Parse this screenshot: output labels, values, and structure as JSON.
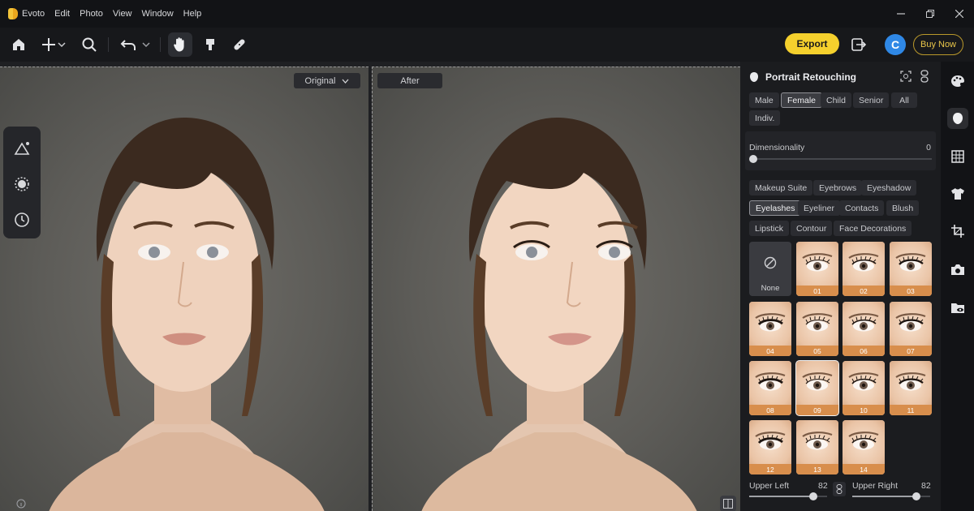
{
  "app": {
    "title": "Evoto"
  },
  "menu": [
    "Edit",
    "Photo",
    "View",
    "Window",
    "Help"
  ],
  "toolbar": {
    "export_label": "Export",
    "avatar_letter": "C",
    "buy_label": "Buy Now"
  },
  "canvas": {
    "left_label": "Original",
    "right_label": "After"
  },
  "panel": {
    "title": "Portrait Retouching",
    "filters": [
      "Male",
      "Female",
      "Child",
      "Senior",
      "All",
      "Indiv."
    ],
    "selected_filter": "Female",
    "dimensionality": {
      "label": "Dimensionality",
      "value": "0"
    },
    "makeup_tabs": [
      "Makeup Suite",
      "Eyebrows",
      "Eyeshadow",
      "Eyelashes",
      "Eyeliner",
      "Contacts",
      "Blush",
      "Lipstick",
      "Contour",
      "Face Decorations"
    ],
    "selected_tab": "Eyelashes",
    "none_label": "None",
    "presets": [
      "01",
      "02",
      "03",
      "04",
      "05",
      "06",
      "07",
      "08",
      "09",
      "10",
      "11",
      "12",
      "13",
      "14"
    ],
    "selected_preset": "09",
    "upper_left": {
      "label": "Upper Left",
      "value": "82",
      "level": 0.82
    },
    "upper_right": {
      "label": "Upper Right",
      "value": "82",
      "level": 0.82
    }
  },
  "colors": {
    "accent": "#f5d02d",
    "tile_label": "#d88e4c",
    "avatar": "#2f88e6"
  },
  "icons": {
    "toolbar": [
      "home-icon",
      "add-icon",
      "chevron-down-icon",
      "search-icon",
      "undo-icon",
      "chevron-down-icon",
      "hand-icon",
      "stamp-icon",
      "bandage-icon",
      "share-icon"
    ],
    "left_tools": [
      "triangle-sparkle-icon",
      "burst-icon",
      "history-icon"
    ],
    "rail": [
      "palette-icon",
      "face-icon",
      "grid-icon",
      "shirt-icon",
      "crop-icon",
      "camera-icon",
      "folder-view-icon"
    ]
  }
}
